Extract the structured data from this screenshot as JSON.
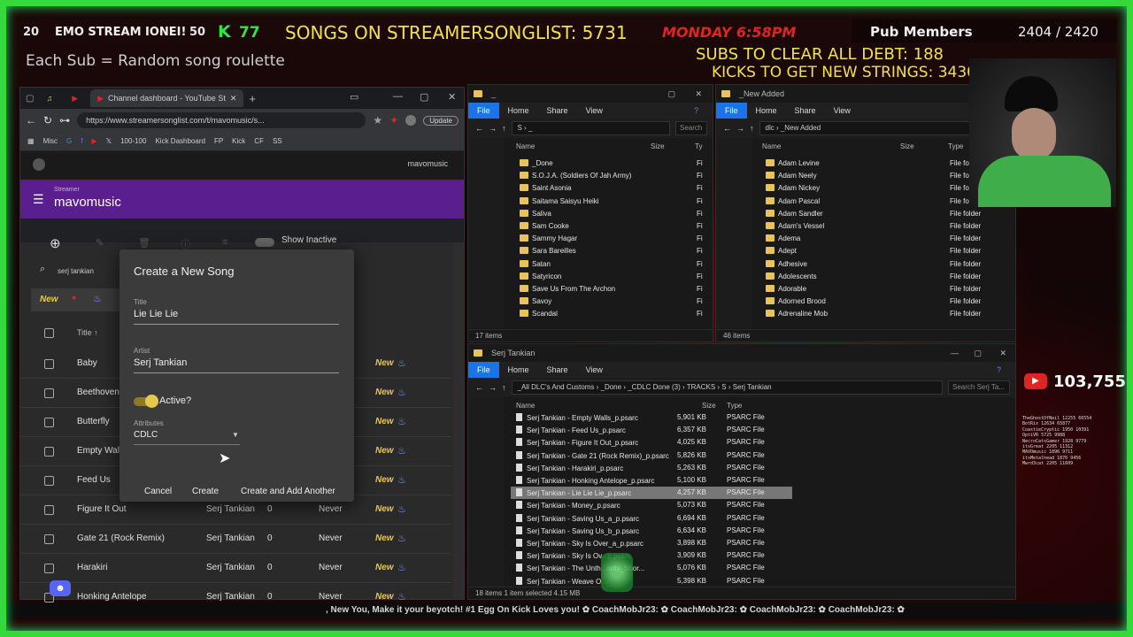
{
  "overlay": {
    "emo_left": "20",
    "emo_title": "EMO STREAM IONEI!",
    "emo_right": "50",
    "kick_badge": "K",
    "kick_count": "77",
    "songs_label": "SONGS ON STREAMERSONGLIST: 5731",
    "day_time": "MONDAY 6:58PM",
    "pub_members_label": "Pub Members",
    "pub_members_count": "2404 / 2420",
    "sub_roulette": "Each Sub = Random song roulette",
    "subs_debt": "SUBS TO CLEAR ALL DEBT: 188",
    "kicks_strings": "KICKS TO GET NEW STRINGS: 3430",
    "youtube_count": "103,755",
    "ticker": ", New You, Make it your beyotch! #1 Egg On Kick Loves you! ✿ CoachMobJr23: ✿ CoachMobJr23: ✿ CoachMobJr23: ✿ CoachMobJr23: ✿",
    "accent_green": "#36d93a",
    "accent_yellow": "#f2e14a",
    "accent_red": "#e02424"
  },
  "browser": {
    "tab1": "Channel dashboard - YouTube St",
    "url": "https://www.streamersonglist.com/t/mavomusic/s...",
    "update_label": "Update",
    "bookmarks": [
      "Misc",
      "100-100",
      "Kick Dashboard",
      "FP",
      "Kick",
      "CF",
      "SS"
    ],
    "app_user": "mavomusic",
    "streamer_label": "Streamer",
    "streamer_name": "mavomusic",
    "show_inactive": "Show Inactive",
    "search_value": "serj tankian",
    "new_filter": "New",
    "col_title": "Title ↑",
    "rows": [
      {
        "title": "Baby",
        "artist": "",
        "count": "",
        "last": "",
        "tag": "New"
      },
      {
        "title": "Beethoven's",
        "artist": "",
        "count": "",
        "last": "",
        "tag": "New"
      },
      {
        "title": "Butterfly",
        "artist": "",
        "count": "",
        "last": "",
        "tag": "New"
      },
      {
        "title": "Empty Walls",
        "artist": "",
        "count": "",
        "last": "",
        "tag": "New"
      },
      {
        "title": "Feed Us",
        "artist": "",
        "count": "",
        "last": "",
        "tag": "New"
      },
      {
        "title": "Figure It Out",
        "artist": "Serj Tankian",
        "count": "0",
        "last": "Never",
        "tag": "New"
      },
      {
        "title": "Gate 21 (Rock Remix)",
        "artist": "Serj Tankian",
        "count": "0",
        "last": "Never",
        "tag": "New"
      },
      {
        "title": "Harakiri",
        "artist": "Serj Tankian",
        "count": "0",
        "last": "Never",
        "tag": "New"
      },
      {
        "title": "Honking Antelope",
        "artist": "Serj Tankian",
        "count": "0",
        "last": "Never",
        "tag": "New"
      }
    ]
  },
  "dialog": {
    "heading": "Create a New Song",
    "title_label": "Title",
    "title_value": "Lie Lie Lie",
    "artist_label": "Artist",
    "artist_value": "Serj Tankian",
    "active_label": "Active?",
    "attributes_label": "Attributes",
    "attributes_value": "CDLC",
    "cancel": "Cancel",
    "create": "Create",
    "create_another": "Create and Add Another"
  },
  "explorer1": {
    "title": "_",
    "ribbon": [
      "File",
      "Home",
      "Share",
      "View"
    ],
    "path": "S › _",
    "search": "Search",
    "col_name": "Name",
    "col_size": "Size",
    "col_type": "Ty",
    "items": [
      "_Done",
      "S.O.J.A. (Soldiers Of Jah Army)",
      "Saint Asonia",
      "Saitama Saisyu Heiki",
      "Saliva",
      "Sam Cooke",
      "Sammy Hagar",
      "Sara Bareilles",
      "Satan",
      "Satyricon",
      "Save Us From The Archon",
      "Savoy",
      "Scandal"
    ],
    "type_abbr": "Fi",
    "status": "17 items"
  },
  "explorer2": {
    "title": "_New Added",
    "ribbon": [
      "File",
      "Home",
      "Share",
      "View"
    ],
    "path": "dlc › _New Added",
    "search": "Se",
    "col_name": "Name",
    "col_size": "Size",
    "col_type": "Type",
    "items": [
      "Adam Levine",
      "Adam Neely",
      "Adam Nickey",
      "Adam Pascal",
      "Adam Sandler",
      "Adam's Vessel",
      "Adema",
      "Adept",
      "Adhesive",
      "Adolescents",
      "Adorable",
      "Adorned Brood",
      "Adrenaline Mob"
    ],
    "type": "File folder",
    "status": "46 items"
  },
  "explorer3": {
    "title": "Serj Tankian",
    "ribbon": [
      "File",
      "Home",
      "Share",
      "View"
    ],
    "path": "_All DLC's And Customs › _Done › _CDLC Done (3) › TRACKS › S › Serj Tankian",
    "search": "Search Serj Ta...",
    "col_name": "Name",
    "col_size": "Size",
    "col_type": "Type",
    "files": [
      {
        "name": "Serj Tankian - Empty Walls_p.psarc",
        "size": "5,901 KB",
        "type": "PSARC File"
      },
      {
        "name": "Serj Tankian - Feed Us_p.psarc",
        "size": "6,357 KB",
        "type": "PSARC File"
      },
      {
        "name": "Serj Tankian - Figure It Out_p.psarc",
        "size": "4,025 KB",
        "type": "PSARC File"
      },
      {
        "name": "Serj Tankian - Gate 21 (Rock Remix)_p.psarc",
        "size": "5,826 KB",
        "type": "PSARC File"
      },
      {
        "name": "Serj Tankian - Harakiri_p.psarc",
        "size": "5,263 KB",
        "type": "PSARC File"
      },
      {
        "name": "Serj Tankian - Honking Antelope_p.psarc",
        "size": "5,100 KB",
        "type": "PSARC File"
      },
      {
        "name": "Serj Tankian - Lie Lie Lie_p.psarc",
        "size": "4,257 KB",
        "type": "PSARC File"
      },
      {
        "name": "Serj Tankian - Money_p.psarc",
        "size": "5,073 KB",
        "type": "PSARC File"
      },
      {
        "name": "Serj Tankian - Saving Us_a_p.psarc",
        "size": "6,694 KB",
        "type": "PSARC File"
      },
      {
        "name": "Serj Tankian - Saving Us_b_p.psarc",
        "size": "6,634 KB",
        "type": "PSARC File"
      },
      {
        "name": "Serj Tankian - Sky Is Over_a_p.psarc",
        "size": "3,898 KB",
        "type": "PSARC File"
      },
      {
        "name": "Serj Tankian - Sky Is Ov...p.psarc",
        "size": "3,909 KB",
        "type": "PSARC File"
      },
      {
        "name": "Serj Tankian - The Unth...ority_Shor...",
        "size": "5,076 KB",
        "type": "PSARC File"
      },
      {
        "name": "Serj Tankian - Weave O...",
        "size": "5,398 KB",
        "type": "PSARC File"
      }
    ],
    "selected_index": 6,
    "status": "18 items   1 item selected  4.15 MB"
  },
  "chat_lines": [
    "TheGhostOfNeil 12255 66554",
    "BotRix 12634 65877",
    "CoastieCryptic 1950 10391",
    "OptiVR 5725 9988",
    "NecroCatsGamer 1928 9779",
    "itsGreat 2205 11312",
    "MAVOmusic 1896 9711",
    "itsMetalhead 1870 9456",
    "Mwrd3cat 2205 11609"
  ]
}
